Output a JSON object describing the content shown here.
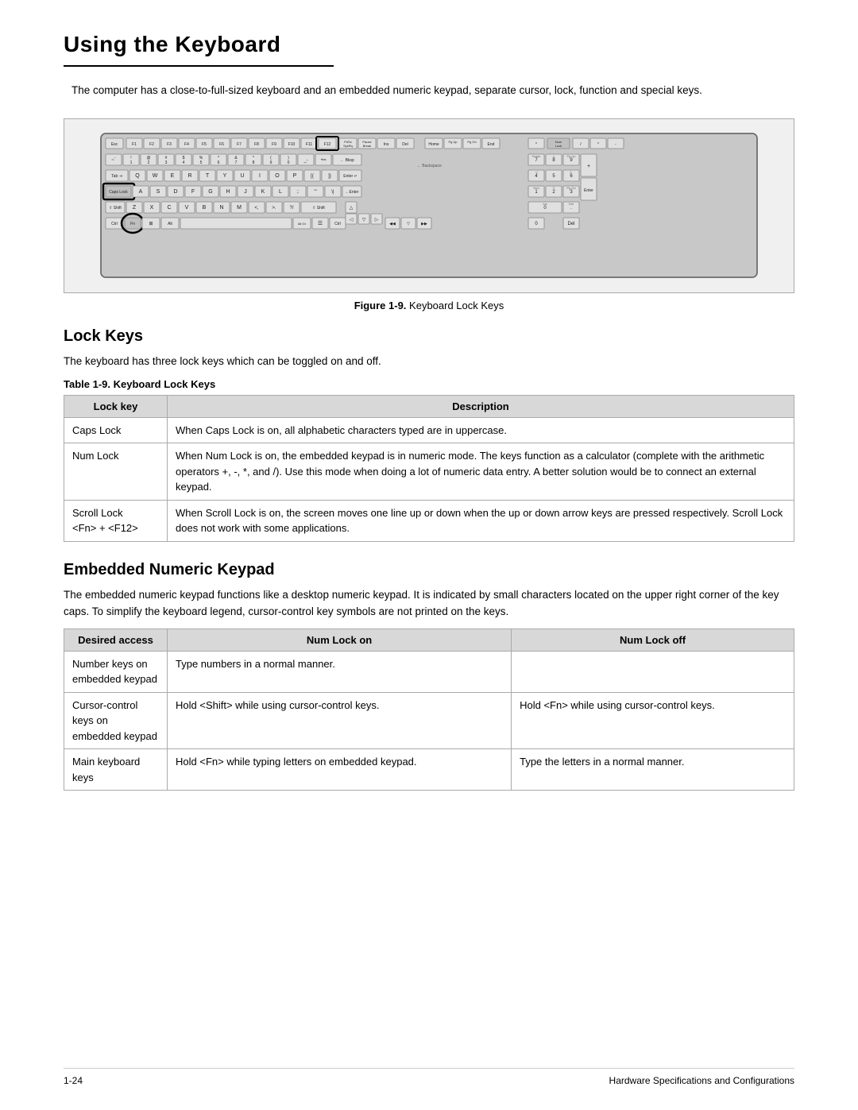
{
  "page": {
    "title": "Using the Keyboard",
    "intro": "The computer has a close-to-full-sized keyboard and an embedded numeric keypad, separate cursor, lock, function and special keys."
  },
  "figure": {
    "caption_bold": "Figure 1-9.",
    "caption_text": "  Keyboard Lock Keys"
  },
  "lock_keys_section": {
    "heading": "Lock Keys",
    "description": "The keyboard has three lock keys which can be toggled on and off.",
    "table_label_bold": "Table 1-9.",
    "table_label_text": "   Keyboard Lock Keys",
    "columns": [
      "Lock key",
      "Description"
    ],
    "rows": [
      {
        "key": "Caps Lock",
        "description": "When Caps Lock is on, all alphabetic characters typed are in uppercase."
      },
      {
        "key": "Num Lock",
        "description": "When Num Lock is on, the embedded keypad is in numeric mode. The keys function as a calculator (complete with the arithmetic operators +, -, *, and /). Use this mode when doing a lot of numeric data entry. A better solution would be to connect an external keypad."
      },
      {
        "key": "Scroll Lock\n<Fn> + <F12>",
        "description": "When Scroll Lock is on, the screen moves one line up or down when the up or down arrow keys are pressed respectively. Scroll Lock does not work with some applications."
      }
    ]
  },
  "embedded_keypad_section": {
    "heading": "Embedded Numeric Keypad",
    "description": "The embedded numeric keypad functions like a desktop numeric keypad. It is indicated by small characters located on the upper right corner of the key caps. To simplify the keyboard legend, cursor-control key symbols are not printed on the keys.",
    "columns": [
      "Desired access",
      "Num Lock on",
      "Num Lock off"
    ],
    "rows": [
      {
        "access": "Number keys on embedded keypad",
        "num_lock_on": "Type numbers in a normal manner.",
        "num_lock_off": ""
      },
      {
        "access": "Cursor-control keys on embedded keypad",
        "num_lock_on": "Hold <Shift> while using cursor-control keys.",
        "num_lock_off": "Hold <Fn> while using cursor-control keys."
      },
      {
        "access": "Main keyboard keys",
        "num_lock_on": "Hold <Fn> while typing letters on embedded keypad.",
        "num_lock_off": "Type the letters in a normal manner."
      }
    ]
  },
  "footer": {
    "page_number": "1-24",
    "section_title": "Hardware Specifications and Configurations"
  }
}
